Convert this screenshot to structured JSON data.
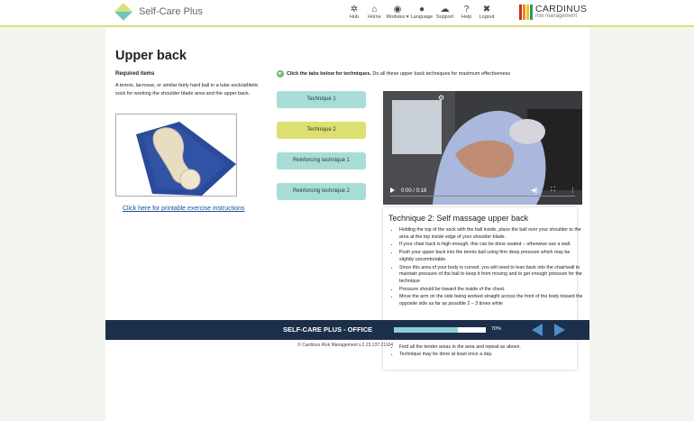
{
  "header": {
    "app_title": "Self-Care Plus",
    "nav": [
      {
        "label": "Hub",
        "icon": "hub-icon"
      },
      {
        "label": "Home",
        "icon": "home-icon"
      },
      {
        "label": "Modules",
        "icon": "modules-icon"
      },
      {
        "label": "Language",
        "icon": "globe-icon"
      },
      {
        "label": "Support",
        "icon": "chat-icon"
      },
      {
        "label": "Help",
        "icon": "help-icon"
      },
      {
        "label": "Logout",
        "icon": "close-icon"
      }
    ],
    "company_name": "CARDINUS",
    "company_sub": "risk management",
    "brand_colors": [
      "#c5311f",
      "#e58c2b",
      "#f2c12e",
      "#2c9c5a"
    ]
  },
  "page": {
    "title": "Upper back",
    "required_heading": "Required items",
    "required_text": "A tennis, lacrosse, or similar fairly hard ball in a tube sock/athletic sock for working the shoulder blade area and the upper back.",
    "printable_link": "Click here for printable exercise instructions",
    "instruction_bold": "Click the tabs below for techniques.",
    "instruction_rest": " Do all these upper back techniques for maximum effectiveness"
  },
  "tabs": [
    {
      "label": "Technique 1",
      "active": false
    },
    {
      "label": "Technique 2",
      "active": true
    },
    {
      "label": "Reinforcing technique 1",
      "active": false
    },
    {
      "label": "Reinforcing technique 2",
      "active": false
    }
  ],
  "video": {
    "time": "0:00 / 0:16"
  },
  "technique": {
    "title": "Technique 2: Self massage upper back",
    "steps": [
      "Holding the top of the sock with the ball inside, place the ball over your shoulder to the area at the top inside edge of your shoulder blade.",
      "If your chair back is high enough, this can be done seated – otherwise use a wall.",
      "Push your upper back into the tennis ball using firm deep pressure which may be slightly uncomfortable.",
      "Since this area of your body is curved, you will need to lean back into the chair/wall to maintain pressure of the ball to keep it from moving and to get enough pressure for the technique",
      "Pressure should be toward the inside of the chest.",
      "Move the arm on the side being worked straight across the front of the body toward the opposite side as far as possible 2 – 3 times while"
    ],
    "steps_below": [
      "Find all the tender areas in the area and repeat as above.",
      "Technique may be done at least once a day."
    ]
  },
  "footer": {
    "title": "SELF-CARE PLUS - OFFICE",
    "progress": 70,
    "progress_label": "70%",
    "copyright": "Cardinus Risk Management v.2.23.137.21104"
  }
}
